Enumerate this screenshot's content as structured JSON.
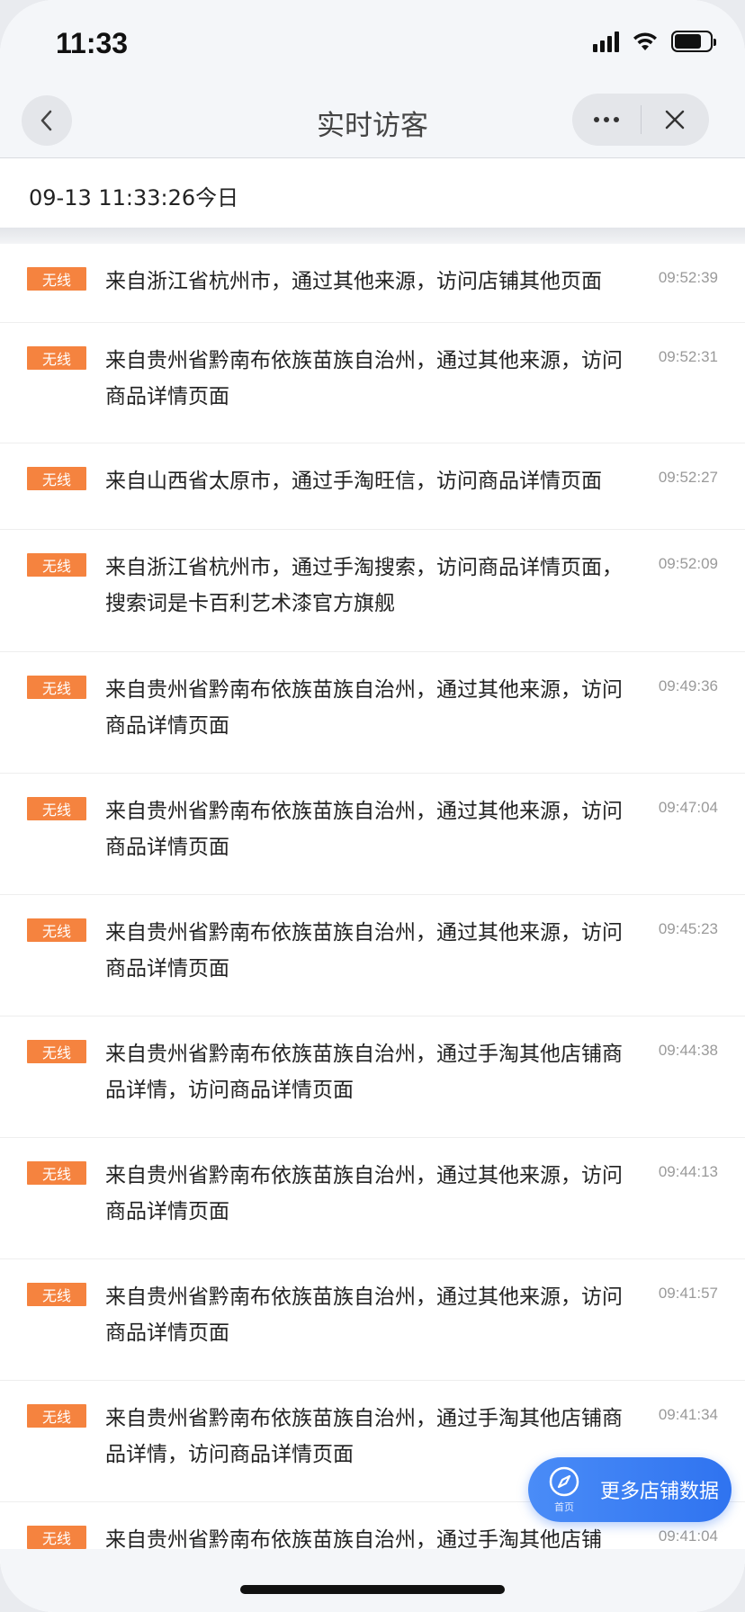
{
  "status_bar": {
    "time": "11:33"
  },
  "nav": {
    "title": "实时访客"
  },
  "date_header": "09-13 11:33:26今日",
  "visitors": [
    {
      "badge": "无线",
      "text": "来自浙江省杭州市，通过其他来源，访问店铺其他页面",
      "time": "09:52:39"
    },
    {
      "badge": "无线",
      "text": "来自贵州省黔南布依族苗族自治州，通过其他来源，访问商品详情页面",
      "time": "09:52:31"
    },
    {
      "badge": "无线",
      "text": "来自山西省太原市，通过手淘旺信，访问商品详情页面",
      "time": "09:52:27"
    },
    {
      "badge": "无线",
      "text": "来自浙江省杭州市，通过手淘搜索，访问商品详情页面，搜索词是卡百利艺术漆官方旗舰",
      "time": "09:52:09"
    },
    {
      "badge": "无线",
      "text": "来自贵州省黔南布依族苗族自治州，通过其他来源，访问商品详情页面",
      "time": "09:49:36"
    },
    {
      "badge": "无线",
      "text": "来自贵州省黔南布依族苗族自治州，通过其他来源，访问商品详情页面",
      "time": "09:47:04"
    },
    {
      "badge": "无线",
      "text": "来自贵州省黔南布依族苗族自治州，通过其他来源，访问商品详情页面",
      "time": "09:45:23"
    },
    {
      "badge": "无线",
      "text": "来自贵州省黔南布依族苗族自治州，通过手淘其他店铺商品详情，访问商品详情页面",
      "time": "09:44:38"
    },
    {
      "badge": "无线",
      "text": "来自贵州省黔南布依族苗族自治州，通过其他来源，访问商品详情页面",
      "time": "09:44:13"
    },
    {
      "badge": "无线",
      "text": "来自贵州省黔南布依族苗族自治州，通过其他来源，访问商品详情页面",
      "time": "09:41:57"
    },
    {
      "badge": "无线",
      "text": "来自贵州省黔南布依族苗族自治州，通过手淘其他店铺商品详情，访问商品详情页面",
      "time": "09:41:34"
    },
    {
      "badge": "无线",
      "text": "来自贵州省黔南布依族苗族自治州，通过手淘其他店铺",
      "time": "09:41:04"
    }
  ],
  "float_button": {
    "icon_label": "首页",
    "label": "更多店铺数据"
  },
  "colors": {
    "badge": "#f5833f",
    "float_button": "#2f73f0",
    "nav_bg": "#f4f6f9"
  },
  "icons": {
    "back": "chevron-left-icon",
    "more": "more-dots-icon",
    "close": "close-icon",
    "compass": "compass-icon"
  }
}
